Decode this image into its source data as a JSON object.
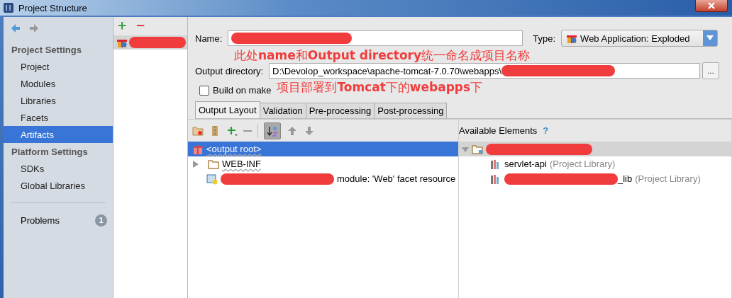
{
  "window": {
    "title": "Project Structure"
  },
  "sidebar": {
    "sections": [
      {
        "heading": "Project Settings",
        "items": [
          {
            "label": "Project",
            "selected": false
          },
          {
            "label": "Modules",
            "selected": false
          },
          {
            "label": "Libraries",
            "selected": false
          },
          {
            "label": "Facets",
            "selected": false
          },
          {
            "label": "Artifacts",
            "selected": true
          }
        ]
      },
      {
        "heading": "Platform Settings",
        "items": [
          {
            "label": "SDKs",
            "selected": false
          },
          {
            "label": "Global Libraries",
            "selected": false
          }
        ]
      }
    ],
    "problems": {
      "label": "Problems",
      "count": "1"
    }
  },
  "artifact_list": {
    "items": [
      {
        "redacted": true,
        "selected": true
      }
    ]
  },
  "form": {
    "name": {
      "label": "Name:",
      "redacted": true
    },
    "type": {
      "label": "Type:",
      "value": "Web Application: Exploded"
    },
    "output_directory": {
      "label": "Output directory:",
      "value": "D:\\Devolop_workspace\\apache-tomcat-7.0.70\\webapps\\",
      "redacted": true,
      "browse": "..."
    },
    "build_on_make": {
      "label": "Build on make",
      "checked": false
    }
  },
  "annotations": [
    {
      "text": "此处**name**和**Output directory**统一命名成项目名称"
    },
    {
      "text": "项目部署到**Tomcat**下的**webapps**下"
    }
  ],
  "tabs": [
    {
      "label": "Output Layout",
      "selected": true
    },
    {
      "label": "Validation",
      "selected": false
    },
    {
      "label": "Pre-processing",
      "selected": false
    },
    {
      "label": "Post-processing",
      "selected": false
    }
  ],
  "layout_tree": [
    {
      "kind": "root",
      "label": "<output root>",
      "selected": true
    },
    {
      "kind": "folder",
      "label": "WEB-INF",
      "selected": false,
      "expanded": false
    },
    {
      "kind": "module",
      "label": "module: 'Web' facet resource",
      "selected": false,
      "redacted": true
    }
  ],
  "available": {
    "heading": "Available Elements",
    "help": "?",
    "tree": [
      {
        "kind": "module",
        "selected": true,
        "redacted": true,
        "expanded": true,
        "children": [
          {
            "label": "servlet-api",
            "note": "(Project Library)",
            "redacted": false
          },
          {
            "label": "_lib",
            "note": "(Project Library)",
            "redacted": true
          }
        ]
      }
    ]
  }
}
